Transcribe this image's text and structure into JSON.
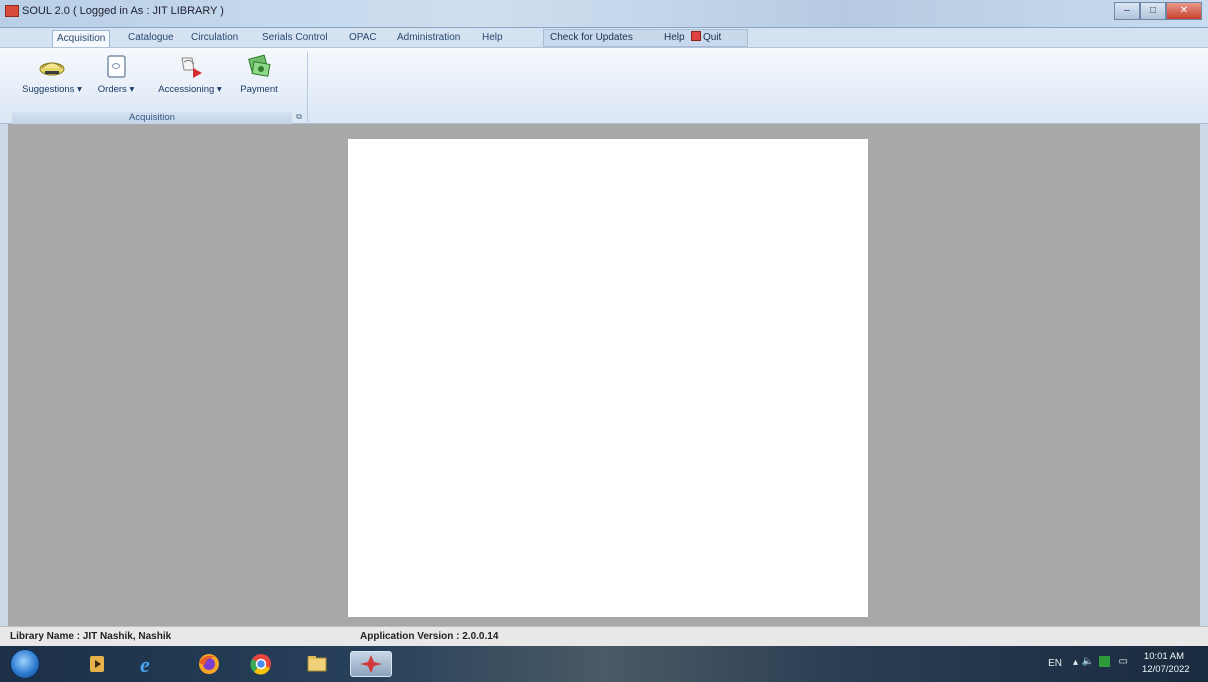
{
  "window": {
    "title": "SOUL 2.0  ( Logged in As : JIT LIBRARY )",
    "min_label": "–",
    "max_label": "□",
    "close_label": "✕"
  },
  "ribbon": {
    "tabs": [
      {
        "label": "Acquisition"
      },
      {
        "label": "Catalogue"
      },
      {
        "label": "Circulation"
      },
      {
        "label": "Serials Control"
      },
      {
        "label": "OPAC"
      },
      {
        "label": "Administration"
      },
      {
        "label": "Help"
      }
    ],
    "quick_access": {
      "check_updates": "Check for Updates",
      "help": "Help",
      "quit": "Quit"
    },
    "group": {
      "caption": "Acquisition",
      "buttons": [
        {
          "label": "Suggestions ▾",
          "icon": "suggestions-icon"
        },
        {
          "label": "Orders ▾",
          "icon": "orders-icon"
        },
        {
          "label": "Accessioning ▾",
          "icon": "accessioning-icon"
        },
        {
          "label": "Payment",
          "icon": "payment-icon"
        }
      ]
    }
  },
  "status": {
    "library": "Library Name : JIT Nashik, Nashik",
    "version": "Application Version : 2.0.0.14"
  },
  "taskbar": {
    "apps": [
      "start-button",
      "media-player-icon",
      "internet-explorer-icon",
      "firefox-icon",
      "chrome-icon",
      "file-explorer-icon",
      "soul-app-icon"
    ],
    "tray_lang": "EN",
    "time": "10:01 AM",
    "date": "12/07/2022"
  }
}
